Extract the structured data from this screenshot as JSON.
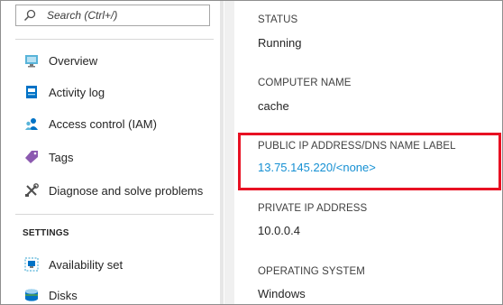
{
  "search": {
    "placeholder": "Search (Ctrl+/)"
  },
  "menu": {
    "items": [
      {
        "label": "Overview",
        "icon": "monitor-icon"
      },
      {
        "label": "Activity log",
        "icon": "activity-log-icon"
      },
      {
        "label": "Access control (IAM)",
        "icon": "people-icon"
      },
      {
        "label": "Tags",
        "icon": "tag-icon"
      },
      {
        "label": "Diagnose and solve problems",
        "icon": "wrench-icon"
      }
    ],
    "settings_title": "SETTINGS",
    "settings_items": [
      {
        "label": "Availability set",
        "icon": "availability-set-icon"
      },
      {
        "label": "Disks",
        "icon": "disks-icon"
      }
    ]
  },
  "details": {
    "status": {
      "label": "STATUS",
      "value": "Running"
    },
    "computer_name": {
      "label": "COMPUTER NAME",
      "value": "cache"
    },
    "public_ip": {
      "label": "PUBLIC IP ADDRESS/DNS NAME LABEL",
      "value": "13.75.145.220/<none>"
    },
    "private_ip": {
      "label": "PRIVATE IP ADDRESS",
      "value": "10.0.0.4"
    },
    "os": {
      "label": "OPERATING SYSTEM",
      "value": "Windows"
    }
  },
  "colors": {
    "link": "#1690d3",
    "highlight": "#e81123",
    "accent": "#0072c6"
  }
}
